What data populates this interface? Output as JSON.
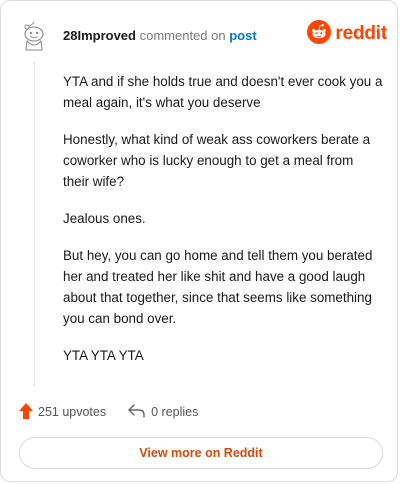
{
  "comment": {
    "username": "28Improved",
    "verb": "commented on",
    "post_link": "post",
    "paragraphs": [
      "YTA and if she holds true and doesn't ever cook you a meal again, it's what you deserve",
      "Honestly, what kind of weak ass coworkers berate a coworker who is lucky enough to get a meal from their wife?",
      "Jealous ones.",
      "But hey, you can go home and tell them you berated her and treated her like shit and have a good laugh about that together, since that seems like something you can bond over.",
      "YTA YTA YTA"
    ]
  },
  "brand": {
    "wordmark": "reddit",
    "icon": "reddit-logo-icon",
    "color": "#ff4500"
  },
  "actions": {
    "upvotes": "251 upvotes",
    "replies": "0 replies",
    "upvote_icon": "upvote-arrow-icon",
    "reply_icon": "reply-arrow-icon",
    "upvote_color": "#ff4500"
  },
  "cta": {
    "label": "View more on Reddit",
    "color": "#d9480f"
  }
}
